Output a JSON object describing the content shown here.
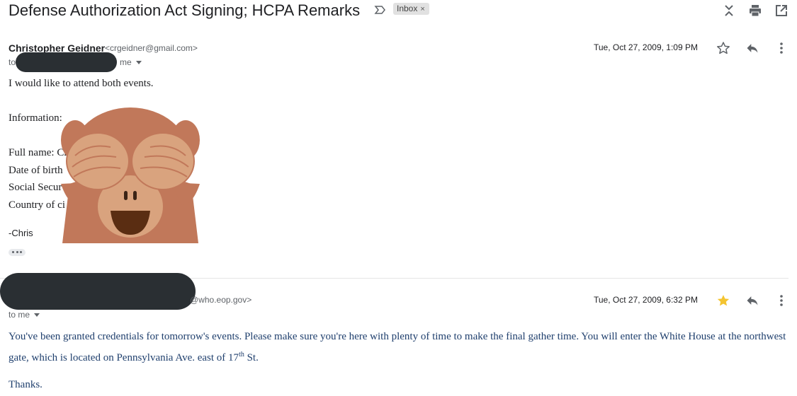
{
  "subject": "Defense Authorization Act Signing; HCPA Remarks",
  "label": {
    "text": "Inbox",
    "remove": "×"
  },
  "icons": [
    "importance-marker-icon",
    "collapse-all-icon",
    "print-icon",
    "open-in-new-window-icon",
    "star-icon",
    "reply-icon",
    "more-vert-icon",
    "monkey-emoji-icon"
  ],
  "message1": {
    "sender_name": "Christopher Geidner",
    "sender_email": "<crgeidner@gmail.com>",
    "to_prefix": "to",
    "to_suffix": "me",
    "date": "Tue, Oct 27, 2009, 1:09 PM",
    "starred": false,
    "body": {
      "line1": "I would like to attend both events.",
      "information": "Information:",
      "full_name": "Full name: Ch",
      "dob": "Date of birth",
      "ssn": "Social Secur",
      "country": "Country of ci",
      "signature": "-Chris"
    }
  },
  "message2": {
    "sender_email": "@who.eop.gov>",
    "to": "to me",
    "date": "Tue, Oct 27, 2009, 6:32 PM",
    "starred": true,
    "body_part1": "You've been granted credentials for tomorrow's events. Please make sure you're here with plenty of time to make the final gather time. You will enter the White House at the northwest gate, which is located on Pennsylvania Ave. east of 17",
    "body_sup": "th",
    "body_part2": " St.",
    "thanks": "Thanks."
  },
  "colors": {
    "star_filled": "#f4c430",
    "redaction": "#2a2f33",
    "body_blue": "#1f3f6d"
  }
}
